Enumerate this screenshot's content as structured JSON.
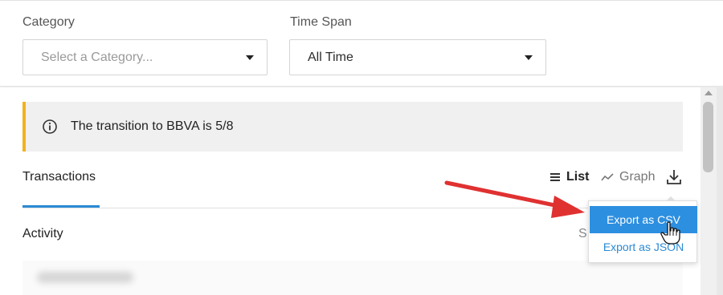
{
  "filters": {
    "category": {
      "label": "Category",
      "placeholder": "Select a Category..."
    },
    "time_span": {
      "label": "Time Span",
      "value": "All Time"
    }
  },
  "alert": {
    "icon": "info-icon",
    "text": "The transition to BBVA is 5/8",
    "accent_color": "#f2b21d"
  },
  "tabs": {
    "active": "Transactions"
  },
  "view": {
    "list_label": "List",
    "graph_label": "Graph",
    "download_icon": "download-icon"
  },
  "section": {
    "title": "Activity",
    "truncated_header": "S"
  },
  "export_menu": {
    "items": [
      {
        "label": "Export as CSV",
        "highlighted": true
      },
      {
        "label": "Export as JSON",
        "highlighted": false
      }
    ]
  },
  "annotation": {
    "arrow_color": "#e03131"
  },
  "colors": {
    "accent": "#2a8ad4",
    "menu_highlight": "#2d8fe0"
  }
}
